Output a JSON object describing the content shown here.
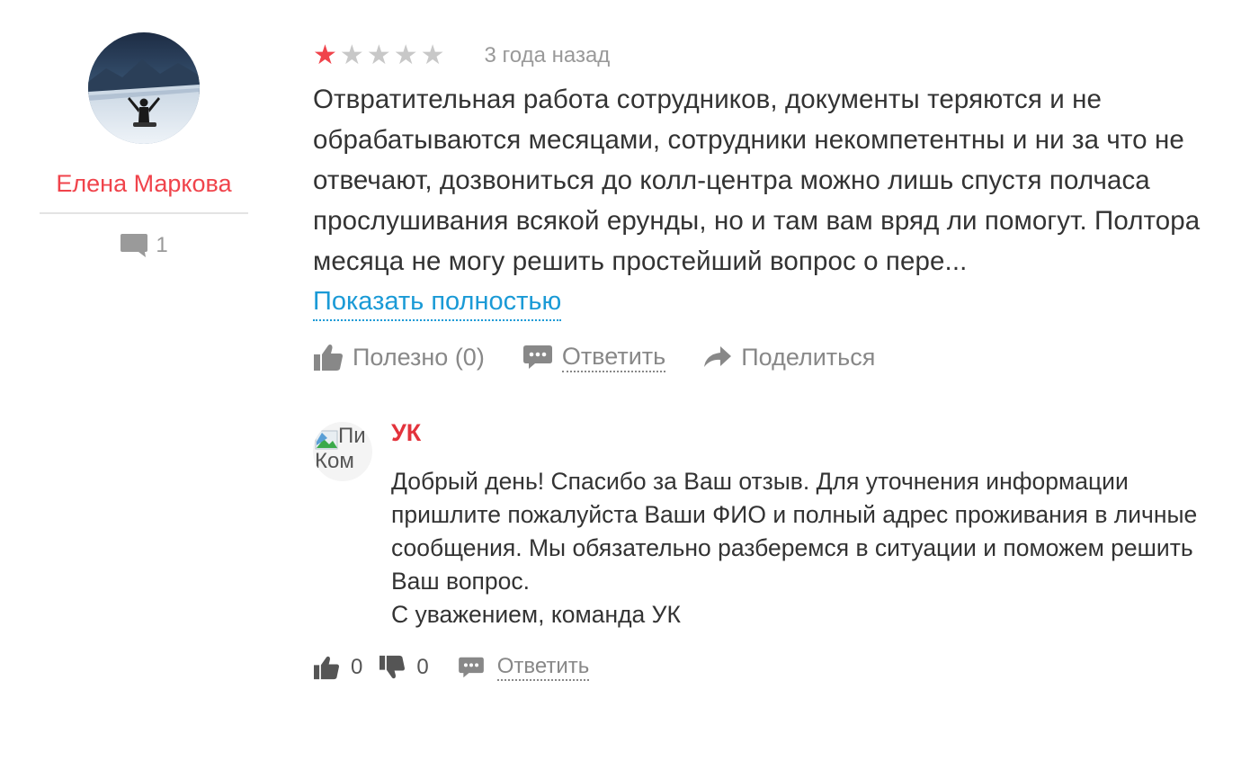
{
  "colors": {
    "accent_red": "#f0434b",
    "link_blue": "#1a9ad6",
    "muted_gray": "#888888",
    "text": "#333333"
  },
  "author": {
    "name": "Елена Маркова",
    "avatar_icon": "user-photo",
    "reviews_count": "1",
    "reviews_icon": "speech-bubble-icon"
  },
  "review": {
    "rating": 1,
    "rating_max": 5,
    "date": "3 года назад",
    "text": "Отвратительная работа сотрудников, документы теряются и не обрабатываются месяцами, сотрудники некомпетентны и ни за что не отвечают, дозвониться до колл-центра можно лишь спустя полчаса прослушивания всякой ерунды, но и там вам вряд ли помогут. Полтора месяца не могу решить простейший вопрос о пере...",
    "show_more_label": "Показать полностью",
    "actions": {
      "helpful_label": "Полезно (0)",
      "reply_label": "Ответить",
      "share_label": "Поделиться"
    }
  },
  "reply": {
    "author": "УК",
    "avatar_alt_line1": "Пи",
    "avatar_alt_line2": "Ком",
    "text_lines": [
      "Добрый день! Спасибо за Ваш отзыв. Для уточнения информации пришлите пожалуйста Ваши ФИО и полный адрес проживания в личные сообщения. Мы обязательно разберемся в ситуации и поможем решить Ваш вопрос.",
      "С уважением, команда УК"
    ],
    "likes": "0",
    "dislikes": "0",
    "reply_label": "Ответить"
  }
}
